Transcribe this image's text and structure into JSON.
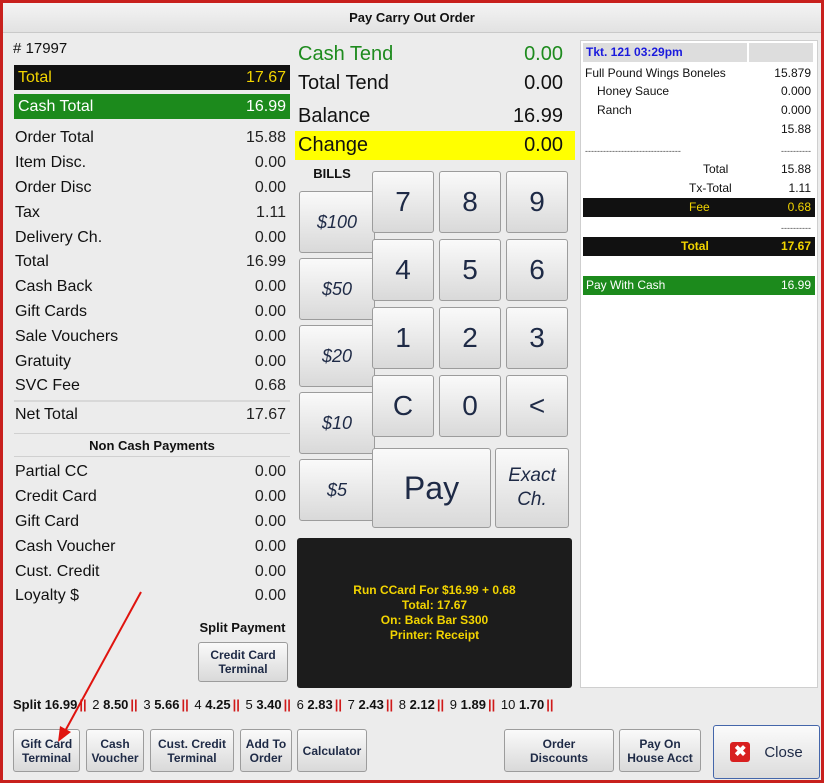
{
  "window": {
    "title": "Pay Carry Out Order"
  },
  "order": {
    "number": "# 17997",
    "total_label": "Total",
    "total_value": "17.67",
    "cash_total_label": "Cash Total",
    "cash_total_value": "16.99",
    "summary": [
      {
        "label": "Order Total",
        "value": "15.88"
      },
      {
        "label": "Item Disc.",
        "value": "0.00"
      },
      {
        "label": "Order Disc",
        "value": "0.00"
      },
      {
        "label": "Tax",
        "value": "1.11"
      },
      {
        "label": "Delivery Ch.",
        "value": "0.00"
      },
      {
        "label": "Total",
        "value": "16.99"
      },
      {
        "label": "Cash Back",
        "value": "0.00"
      },
      {
        "label": "Gift Cards",
        "value": "0.00"
      },
      {
        "label": "Sale Vouchers",
        "value": "0.00"
      },
      {
        "label": "Gratuity",
        "value": "0.00"
      },
      {
        "label": "SVC Fee",
        "value": "0.68"
      }
    ],
    "net_total_label": "Net Total",
    "net_total_value": "17.67",
    "non_cash_title": "Non Cash Payments",
    "non_cash": [
      {
        "label": "Partial CC",
        "value": "0.00"
      },
      {
        "label": "Credit Card",
        "value": "0.00"
      },
      {
        "label": "Gift Card",
        "value": "0.00"
      },
      {
        "label": "Cash Voucher",
        "value": "0.00"
      },
      {
        "label": "Cust. Credit",
        "value": "0.00"
      },
      {
        "label": "Loyalty $",
        "value": "0.00"
      }
    ],
    "split_payment_label": "Split Payment",
    "credit_card_terminal_label": [
      "Credit Card",
      "Terminal"
    ]
  },
  "tender": {
    "cash_tend_label": "Cash Tend",
    "cash_tend_value": "0.00",
    "total_tend_label": "Total Tend",
    "total_tend_value": "0.00",
    "balance_label": "Balance",
    "balance_value": "16.99",
    "change_label": "Change",
    "change_value": "0.00",
    "bills_label": "BILLS",
    "bills": [
      "$100",
      "$50",
      "$20",
      "$10",
      "$5"
    ],
    "keys": [
      "7",
      "8",
      "9",
      "4",
      "5",
      "6",
      "1",
      "2",
      "3",
      "C",
      "0",
      "<"
    ],
    "pay_label": "Pay",
    "exact_label": [
      "Exact",
      "Ch."
    ],
    "message": [
      "Run CCard For $16.99 + 0.68",
      "Total: 17.67",
      "On: Back Bar S300",
      "Printer: Receipt"
    ]
  },
  "ticket": {
    "header": "Tkt. 121  03:29pm",
    "items": [
      {
        "label": "Full Pound Wings Boneles",
        "value": "15.879",
        "indent": false
      },
      {
        "label": "Honey Sauce",
        "value": "0.000",
        "indent": true
      },
      {
        "label": "Ranch",
        "value": "0.000",
        "indent": true
      },
      {
        "label": "",
        "value": "15.88",
        "indent": false
      }
    ],
    "dash_left": "--------------------------------",
    "dash_right": "----------",
    "total_label": "Total",
    "total_value": "15.88",
    "tx_label": "Tx-Total",
    "tx_value": "1.11",
    "fee_label": "Fee",
    "fee_value": "0.68",
    "dash_right2": "----------",
    "grand_label": "Total",
    "grand_value": "17.67",
    "pay_label": "Pay With Cash",
    "pay_value": "16.99"
  },
  "splits": [
    {
      "n": "Split",
      "v": "16.99"
    },
    {
      "n": "2",
      "v": "8.50"
    },
    {
      "n": "3",
      "v": "5.66"
    },
    {
      "n": "4",
      "v": "4.25"
    },
    {
      "n": "5",
      "v": "3.40"
    },
    {
      "n": "6",
      "v": "2.83"
    },
    {
      "n": "7",
      "v": "2.43"
    },
    {
      "n": "8",
      "v": "2.12"
    },
    {
      "n": "9",
      "v": "1.89"
    },
    {
      "n": "10",
      "v": "1.70"
    }
  ],
  "split_sep": "||",
  "bottom": {
    "gift_card_terminal": [
      "Gift Card",
      "Terminal"
    ],
    "cash_voucher": [
      "Cash",
      "Voucher"
    ],
    "cust_credit_terminal": [
      "Cust. Credit",
      "Terminal"
    ],
    "add_to_order": [
      "Add To",
      "Order"
    ],
    "calculator": "Calculator",
    "order_discounts": [
      "Order",
      "Discounts"
    ],
    "pay_on_house": [
      "Pay On",
      "House Acct"
    ],
    "close": "Close"
  },
  "colors": {
    "accent_red": "#d82020",
    "cash_green": "#1c8a1c",
    "highlight_yellow": "#ffff00",
    "annotation_arrow": "#e0140f"
  },
  "icons": {
    "close": "close-icon",
    "annotation": "red-arrow-annotation"
  }
}
